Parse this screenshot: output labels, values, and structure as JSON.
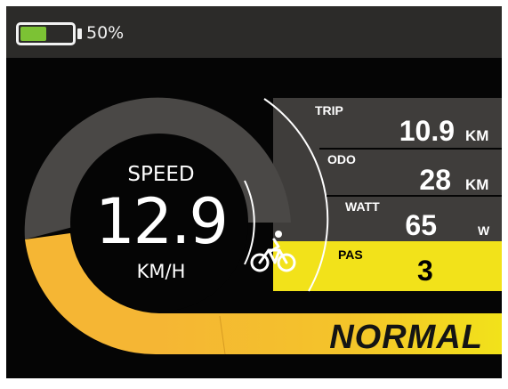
{
  "status": {
    "battery_percent": 50,
    "battery_text": "50%",
    "battery_color": "#7cc234"
  },
  "speed": {
    "label": "SPEED",
    "value": "12.9",
    "unit": "KM/H"
  },
  "trip": {
    "label": "TRIP",
    "value": "10.9",
    "unit": "KM"
  },
  "odo": {
    "label": "ODO",
    "value": "28",
    "unit": "KM"
  },
  "watt": {
    "label": "WATT",
    "value": "65",
    "unit": "W"
  },
  "pas": {
    "label": "PAS",
    "value": "3"
  },
  "mode": {
    "label": "NORMAL"
  },
  "colors": {
    "accent": "#f5b634",
    "highlight": "#f2e21a",
    "panel": "#3f3d3b",
    "background": "#050505",
    "status_bar": "#2c2b29"
  },
  "icons": {
    "battery": "battery-icon",
    "bicycle": "bicycle-rider-icon"
  }
}
